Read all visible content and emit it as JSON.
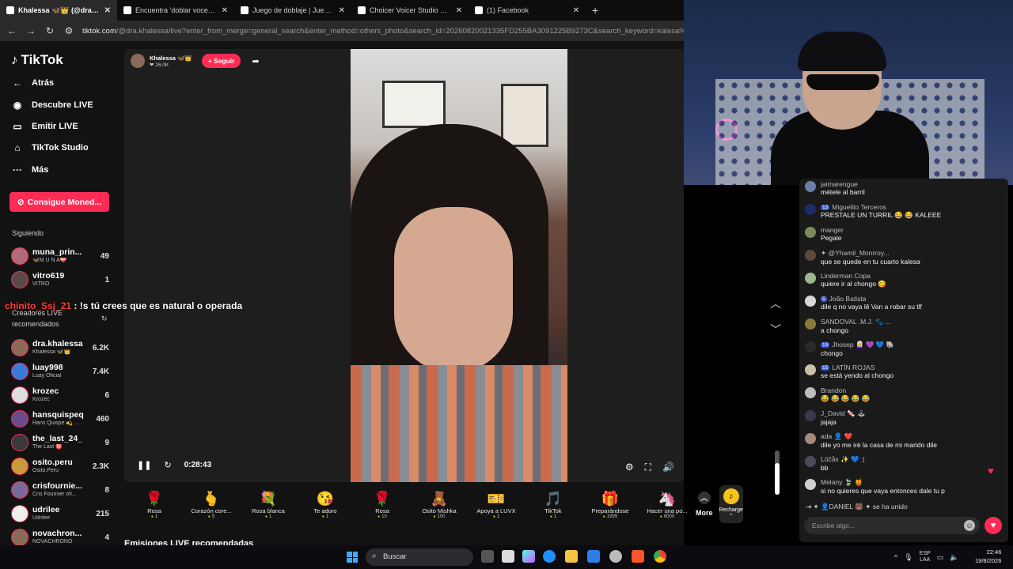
{
  "browser": {
    "tabs": [
      {
        "title": "Khalessa 🦋👑 (@dra.kha",
        "active": true
      },
      {
        "title": "Encuentra 'doblar voces pelicul",
        "active": false
      },
      {
        "title": "Juego de doblaje | Juega a Cho",
        "active": false
      },
      {
        "title": "Choicer Voicer Studio — Free C",
        "active": false
      },
      {
        "title": "(1) Facebook",
        "active": false
      }
    ],
    "url_host": "tiktok.com",
    "url_path": "/@dra.khalessa/live?enter_from_merge=general_search&enter_method=others_photo&search_id=20260820021335FD255BA3091225B9273C&search_keyword=kalesa%20chavo&search_re"
  },
  "sidebar": {
    "logo_text": "TikTok",
    "nav": [
      {
        "icon": "back-arrow-icon",
        "glyph": "←",
        "label": "Atrás"
      },
      {
        "icon": "live-avatar-icon",
        "glyph": "◉",
        "label": "Descubre LIVE"
      },
      {
        "icon": "camera-icon",
        "glyph": "▭",
        "label": "Emitir LIVE"
      },
      {
        "icon": "home-icon",
        "glyph": "⌂",
        "label": "TikTok Studio"
      },
      {
        "icon": "more-dots-icon",
        "glyph": "···",
        "label": "Más"
      }
    ],
    "coins_button": "Consigue Moned...",
    "following_title": "Siguiendo",
    "following": [
      {
        "name": "muna_prin...",
        "sub": "🦋M U N A💝",
        "count": "49"
      },
      {
        "name": "vitro619",
        "sub": "VITRO",
        "count": "1"
      }
    ],
    "recommended_title": "Creadores LIVE recomendados",
    "recommended": [
      {
        "name": "dra.khalessa",
        "sub": "Khalessa 🦋👑",
        "count": "6.2K"
      },
      {
        "name": "luay998",
        "sub": "Luay Oficial",
        "count": "7.4K"
      },
      {
        "name": "krozec",
        "sub": "Krozec",
        "count": "6"
      },
      {
        "name": "hansquispeq",
        "sub": "Hans Quispe 💫 ...",
        "count": "460"
      },
      {
        "name": "the_last_24_",
        "sub": "The Last ㊗️",
        "count": "9"
      },
      {
        "name": "osito.peru",
        "sub": "Osito.Peru",
        "count": "2.3K"
      },
      {
        "name": "crisfournie...",
        "sub": "Cris Fournier ofi...",
        "count": "8"
      },
      {
        "name": "udrilee",
        "sub": "Udrilee",
        "count": "215"
      },
      {
        "name": "novachron...",
        "sub": "NOVACHRONO",
        "count": "4"
      }
    ]
  },
  "stream": {
    "host_name": "Khalessa 🦋👑",
    "host_likes": "❤ 26.0K",
    "follow_label": "+ Seguir",
    "timer": "0:28:43",
    "volume_level": 0.72
  },
  "gifts": [
    {
      "icon": "🌹",
      "name": "Rosa",
      "price": "1"
    },
    {
      "icon": "🫰",
      "name": "Corazón core...",
      "price": "5"
    },
    {
      "icon": "💐",
      "name": "Rosa blanca",
      "price": "1"
    },
    {
      "icon": "😘",
      "name": "Te adoro",
      "price": "1"
    },
    {
      "icon": "🌹",
      "name": "Rosa",
      "price": "10"
    },
    {
      "icon": "🧸",
      "name": "Osito Mishka",
      "price": "100"
    },
    {
      "icon": "🎫",
      "name": "Apoya a LUVX",
      "price": "1"
    },
    {
      "icon": "🎵",
      "name": "TikTok",
      "price": "1"
    },
    {
      "icon": "🎁",
      "name": "Preparándose",
      "price": "1999"
    },
    {
      "icon": "🦄",
      "name": "Hacer una po...",
      "price": "6000"
    }
  ],
  "gift_more_label": "More",
  "recharge_label": "Recharge ⌃",
  "recommended_streams_title": "Emisiones LIVE recomendadas",
  "overlay": {
    "user": "chinito_Ssj_21",
    "text": " : !s tú crees que es natural o operada"
  },
  "chat": {
    "messages": [
      {
        "badge": "",
        "user": "jaimarengue",
        "text": "métele al barril",
        "color": "#6b7fa8"
      },
      {
        "badge": "13",
        "user": "Miguelito Terceros",
        "text": "PRESTALE UN TURRIL 😂 😂 KALEEE",
        "color": "#1d2b6b"
      },
      {
        "badge": "",
        "user": "manger",
        "text": "Pegale",
        "color": "#7a8c5a"
      },
      {
        "badge": "",
        "user": "✦ @Yhamil_Monrroy...",
        "text": "que se quede en tu cuarto kalesa",
        "color": "#5a4a3a"
      },
      {
        "badge": "",
        "user": "Linderman Copa",
        "text": "quiere ir al chongo 😋",
        "color": "#9ab88a"
      },
      {
        "badge": "5",
        "user": "João Batista",
        "text": "dile q no vaya lê Van a robar su tlf",
        "color": "#d8d8d8"
      },
      {
        "badge": "",
        "user": "SANDOVAL .M.J. 🐾 ...",
        "text": "a chongo",
        "color": "#8a7a3a"
      },
      {
        "badge": "13",
        "user": "Jhosep 👩‍🦳 💜 💙 🐘",
        "text": "chongo",
        "color": "#2a2a2a"
      },
      {
        "badge": "15",
        "user": "LATÍN ROJAS",
        "text": "se está yendo al chongo",
        "color": "#c8c0a8"
      },
      {
        "badge": "",
        "user": "Brandon",
        "text": "😂 😂 😂 😂 😂",
        "color": "#bdbdbd"
      },
      {
        "badge": "",
        "user": "J_David 🍬 🕹",
        "text": "jajaja",
        "color": "#3a3a4a"
      },
      {
        "badge": "",
        "user": "ada 👤 ❤️",
        "text": "dile yo me iré la casa de mi marido dile",
        "color": "#a88a7a"
      },
      {
        "badge": "",
        "user": "Lûčås ✨ 💙 :|",
        "text": "bb",
        "color": "#4a4a5a"
      },
      {
        "badge": "",
        "user": "Melany 🍃 🍯",
        "text": "si no quieres que vaya entonces dale tu p",
        "color": "#d0d0d0"
      }
    ],
    "join_text": "✦ 👤DANIEL 🐻 ✦   se ha unido",
    "input_placeholder": "Escribe algo..."
  },
  "taskbar": {
    "search_label": "Buscar",
    "lang": "ESP",
    "lang_sub": "LAA",
    "time": "22:46",
    "date": "19/8/2026"
  }
}
